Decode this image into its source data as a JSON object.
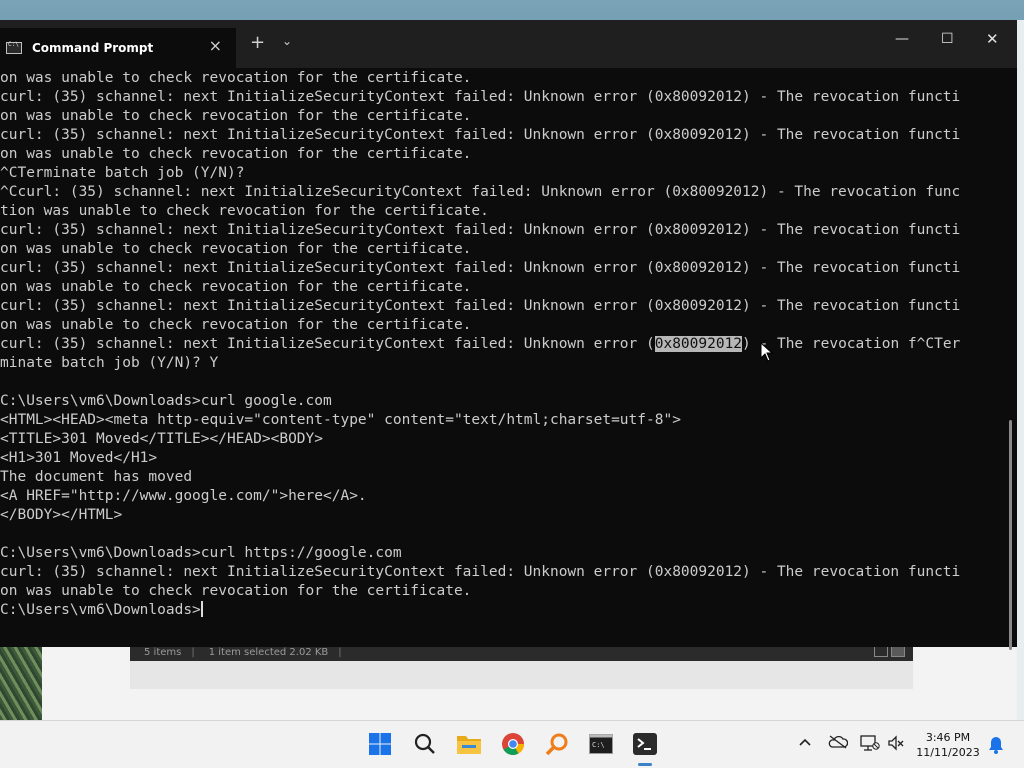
{
  "window": {
    "tab_title": "Command Prompt",
    "tab_close": "×",
    "new_tab": "+",
    "dropdown": "⌄",
    "minimize": "—",
    "maximize": "☐",
    "close": "✕"
  },
  "console": {
    "lines": [
      "on was unable to check revocation for the certificate.",
      "curl: (35) schannel: next InitializeSecurityContext failed: Unknown error (0x80092012) - The revocation functi",
      "on was unable to check revocation for the certificate.",
      "curl: (35) schannel: next InitializeSecurityContext failed: Unknown error (0x80092012) - The revocation functi",
      "on was unable to check revocation for the certificate.",
      "^CTerminate batch job (Y/N)?",
      "^Ccurl: (35) schannel: next InitializeSecurityContext failed: Unknown error (0x80092012) - The revocation func",
      "tion was unable to check revocation for the certificate.",
      "curl: (35) schannel: next InitializeSecurityContext failed: Unknown error (0x80092012) - The revocation functi",
      "on was unable to check revocation for the certificate.",
      "curl: (35) schannel: next InitializeSecurityContext failed: Unknown error (0x80092012) - The revocation functi",
      "on was unable to check revocation for the certificate.",
      "curl: (35) schannel: next InitializeSecurityContext failed: Unknown error (0x80092012) - The revocation functi",
      "on was unable to check revocation for the certificate.",
      "curl: (35) schannel: next InitializeSecurityContext failed: Unknown error (0x80092012) - The revocation f^CTer",
      "minate batch job (Y/N)? Y",
      "",
      "C:\\Users\\vm6\\Downloads>curl google.com",
      "<HTML><HEAD><meta http-equiv=\"content-type\" content=\"text/html;charset=utf-8\">",
      "<TITLE>301 Moved</TITLE></HEAD><BODY>",
      "<H1>301 Moved</H1>",
      "The document has moved",
      "<A HREF=\"http://www.google.com/\">here</A>.",
      "</BODY></HTML>",
      "",
      "C:\\Users\\vm6\\Downloads>curl https://google.com",
      "curl: (35) schannel: next InitializeSecurityContext failed: Unknown error (0x80092012) - The revocation functi",
      "on was unable to check revocation for the certificate.",
      ""
    ],
    "prompt": "C:\\Users\\vm6\\Downloads>",
    "highlighted_text": "0x80092012",
    "highlighted_line_index": 14
  },
  "explorer_status": {
    "items": "5 items",
    "selected": "1 item selected  2.02 KB"
  },
  "taskbar": {
    "time": "3:46 PM",
    "date": "11/11/2023",
    "colors": {
      "windows": "#1a73e8",
      "folder": "#f6c343",
      "search_app": "#f07c1a"
    }
  }
}
